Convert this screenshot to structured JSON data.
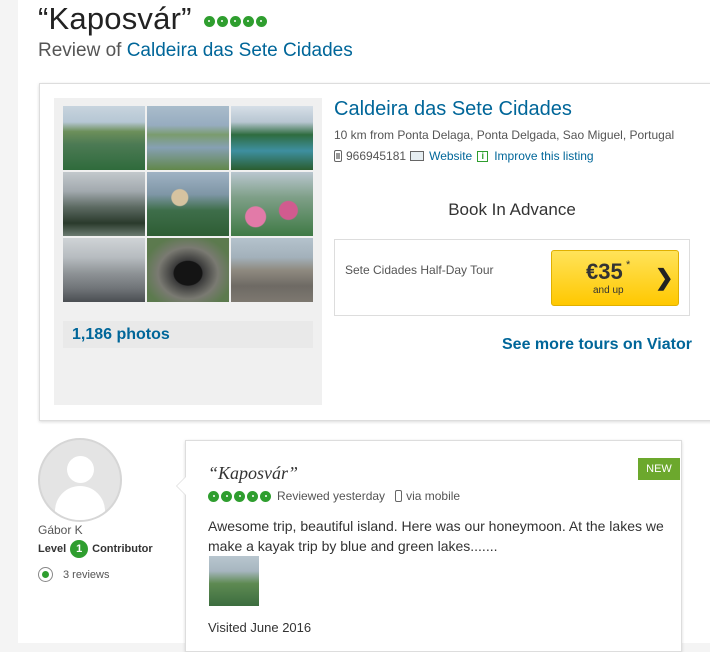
{
  "header": {
    "title": "“Kaposvár”",
    "rating_bubbles": 5,
    "subtitle_prefix": "Review of",
    "subtitle_link": "Caldeira das Sete Cidades"
  },
  "listing": {
    "name": "Caldeira das Sete Cidades",
    "address": "10 km from Ponta Delaga, Ponta Delgada, Sao Miguel, Portugal",
    "phone": "966945181",
    "website_label": "Website",
    "improve_label": "Improve this listing",
    "photos_count_label": "1,186 photos",
    "book_title": "Book In Advance",
    "tour": {
      "name": "Sete Cidades Half-Day Tour",
      "price": "€35",
      "price_mark": "*",
      "price_sub": "and up"
    },
    "more_tours_label": "See more tours on Viator"
  },
  "reviewer": {
    "username": "Gábor K",
    "level_prefix": "Level",
    "level_number": "1",
    "level_suffix": "Contributor",
    "reviews_count": "3 reviews"
  },
  "review": {
    "badge": "NEW",
    "title": "“Kaposvár”",
    "rating_bubbles": 5,
    "reviewed_label": "Reviewed yesterday",
    "device_label": "via mobile",
    "text": "Awesome trip, beautiful island. Here was our honeymoon. At the lakes we make a kayak trip by blue and green lakes.......",
    "visited": "Visited June 2016"
  },
  "colors": {
    "link": "#006699",
    "rating_green": "#2f9e2f",
    "new_badge": "#6ca82d",
    "price_button": "#ffcc00"
  }
}
